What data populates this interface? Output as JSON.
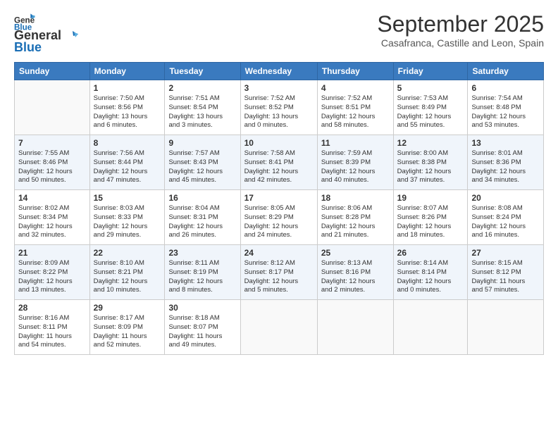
{
  "header": {
    "logo_general": "General",
    "logo_blue": "Blue",
    "month_title": "September 2025",
    "location": "Casafranca, Castille and Leon, Spain"
  },
  "weekdays": [
    "Sunday",
    "Monday",
    "Tuesday",
    "Wednesday",
    "Thursday",
    "Friday",
    "Saturday"
  ],
  "weeks": [
    [
      {
        "day": "",
        "info": ""
      },
      {
        "day": "1",
        "info": "Sunrise: 7:50 AM\nSunset: 8:56 PM\nDaylight: 13 hours\nand 6 minutes."
      },
      {
        "day": "2",
        "info": "Sunrise: 7:51 AM\nSunset: 8:54 PM\nDaylight: 13 hours\nand 3 minutes."
      },
      {
        "day": "3",
        "info": "Sunrise: 7:52 AM\nSunset: 8:52 PM\nDaylight: 13 hours\nand 0 minutes."
      },
      {
        "day": "4",
        "info": "Sunrise: 7:52 AM\nSunset: 8:51 PM\nDaylight: 12 hours\nand 58 minutes."
      },
      {
        "day": "5",
        "info": "Sunrise: 7:53 AM\nSunset: 8:49 PM\nDaylight: 12 hours\nand 55 minutes."
      },
      {
        "day": "6",
        "info": "Sunrise: 7:54 AM\nSunset: 8:48 PM\nDaylight: 12 hours\nand 53 minutes."
      }
    ],
    [
      {
        "day": "7",
        "info": "Sunrise: 7:55 AM\nSunset: 8:46 PM\nDaylight: 12 hours\nand 50 minutes."
      },
      {
        "day": "8",
        "info": "Sunrise: 7:56 AM\nSunset: 8:44 PM\nDaylight: 12 hours\nand 47 minutes."
      },
      {
        "day": "9",
        "info": "Sunrise: 7:57 AM\nSunset: 8:43 PM\nDaylight: 12 hours\nand 45 minutes."
      },
      {
        "day": "10",
        "info": "Sunrise: 7:58 AM\nSunset: 8:41 PM\nDaylight: 12 hours\nand 42 minutes."
      },
      {
        "day": "11",
        "info": "Sunrise: 7:59 AM\nSunset: 8:39 PM\nDaylight: 12 hours\nand 40 minutes."
      },
      {
        "day": "12",
        "info": "Sunrise: 8:00 AM\nSunset: 8:38 PM\nDaylight: 12 hours\nand 37 minutes."
      },
      {
        "day": "13",
        "info": "Sunrise: 8:01 AM\nSunset: 8:36 PM\nDaylight: 12 hours\nand 34 minutes."
      }
    ],
    [
      {
        "day": "14",
        "info": "Sunrise: 8:02 AM\nSunset: 8:34 PM\nDaylight: 12 hours\nand 32 minutes."
      },
      {
        "day": "15",
        "info": "Sunrise: 8:03 AM\nSunset: 8:33 PM\nDaylight: 12 hours\nand 29 minutes."
      },
      {
        "day": "16",
        "info": "Sunrise: 8:04 AM\nSunset: 8:31 PM\nDaylight: 12 hours\nand 26 minutes."
      },
      {
        "day": "17",
        "info": "Sunrise: 8:05 AM\nSunset: 8:29 PM\nDaylight: 12 hours\nand 24 minutes."
      },
      {
        "day": "18",
        "info": "Sunrise: 8:06 AM\nSunset: 8:28 PM\nDaylight: 12 hours\nand 21 minutes."
      },
      {
        "day": "19",
        "info": "Sunrise: 8:07 AM\nSunset: 8:26 PM\nDaylight: 12 hours\nand 18 minutes."
      },
      {
        "day": "20",
        "info": "Sunrise: 8:08 AM\nSunset: 8:24 PM\nDaylight: 12 hours\nand 16 minutes."
      }
    ],
    [
      {
        "day": "21",
        "info": "Sunrise: 8:09 AM\nSunset: 8:22 PM\nDaylight: 12 hours\nand 13 minutes."
      },
      {
        "day": "22",
        "info": "Sunrise: 8:10 AM\nSunset: 8:21 PM\nDaylight: 12 hours\nand 10 minutes."
      },
      {
        "day": "23",
        "info": "Sunrise: 8:11 AM\nSunset: 8:19 PM\nDaylight: 12 hours\nand 8 minutes."
      },
      {
        "day": "24",
        "info": "Sunrise: 8:12 AM\nSunset: 8:17 PM\nDaylight: 12 hours\nand 5 minutes."
      },
      {
        "day": "25",
        "info": "Sunrise: 8:13 AM\nSunset: 8:16 PM\nDaylight: 12 hours\nand 2 minutes."
      },
      {
        "day": "26",
        "info": "Sunrise: 8:14 AM\nSunset: 8:14 PM\nDaylight: 12 hours\nand 0 minutes."
      },
      {
        "day": "27",
        "info": "Sunrise: 8:15 AM\nSunset: 8:12 PM\nDaylight: 11 hours\nand 57 minutes."
      }
    ],
    [
      {
        "day": "28",
        "info": "Sunrise: 8:16 AM\nSunset: 8:11 PM\nDaylight: 11 hours\nand 54 minutes."
      },
      {
        "day": "29",
        "info": "Sunrise: 8:17 AM\nSunset: 8:09 PM\nDaylight: 11 hours\nand 52 minutes."
      },
      {
        "day": "30",
        "info": "Sunrise: 8:18 AM\nSunset: 8:07 PM\nDaylight: 11 hours\nand 49 minutes."
      },
      {
        "day": "",
        "info": ""
      },
      {
        "day": "",
        "info": ""
      },
      {
        "day": "",
        "info": ""
      },
      {
        "day": "",
        "info": ""
      }
    ]
  ]
}
